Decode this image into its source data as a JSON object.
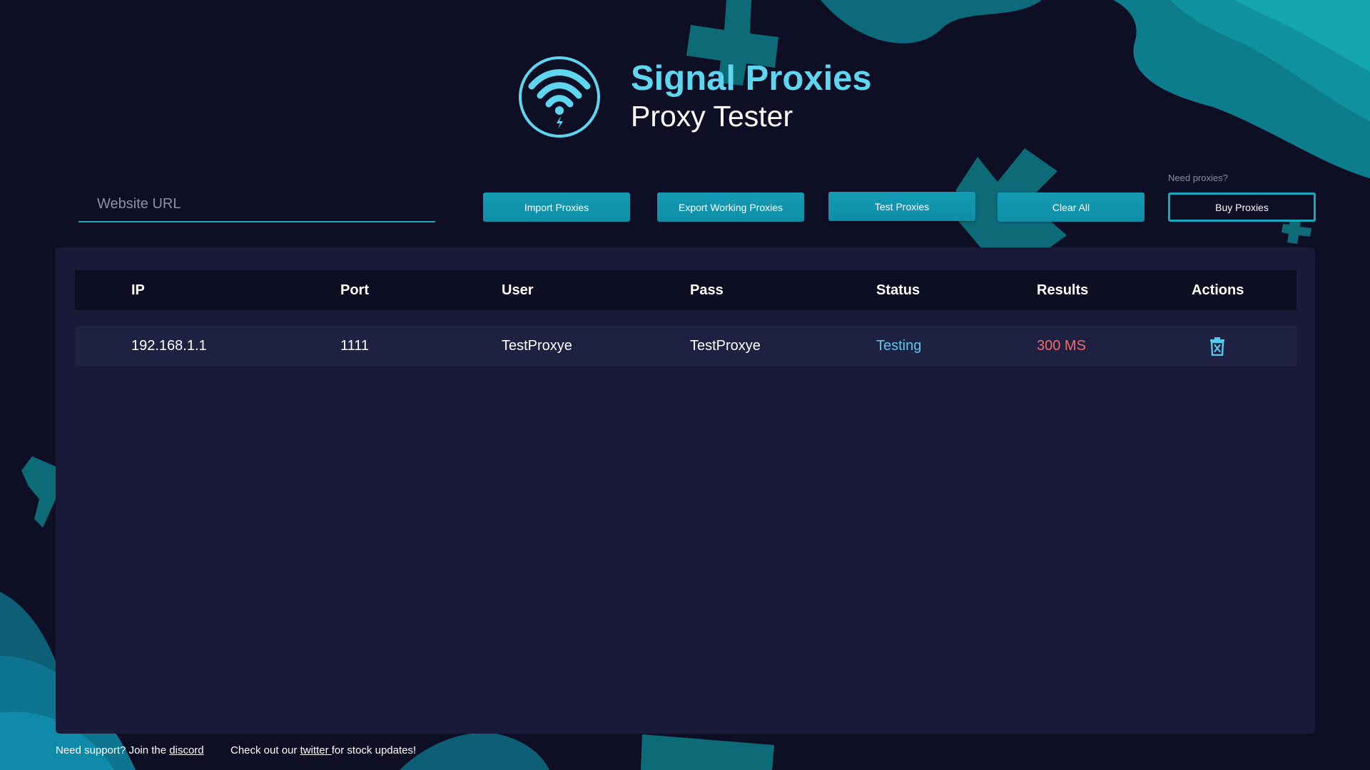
{
  "brand": {
    "title": "Signal Proxies",
    "subtitle": "Proxy Tester",
    "logo_icon": "wifi-bolt-icon"
  },
  "search": {
    "placeholder": "Website URL",
    "value": ""
  },
  "toolbar": {
    "import_label": "Import Proxies",
    "export_label": "Export Working Proxies",
    "test_label": "Test Proxies",
    "clear_label": "Clear All",
    "need_proxies_label": "Need proxies?",
    "buy_label": "Buy Proxies"
  },
  "table": {
    "headers": [
      "IP",
      "Port",
      "User",
      "Pass",
      "Status",
      "Results",
      "Actions"
    ],
    "rows": [
      {
        "ip": "192.168.1.1",
        "port": "1111",
        "user": "TestProxye",
        "pass": "TestProxye",
        "status": "Testing",
        "result": "300 MS",
        "action_icon": "trash-icon"
      }
    ]
  },
  "footer": {
    "support_prefix": "Need support? Join the ",
    "support_link": "discord",
    "twitter_prefix": "Check out our ",
    "twitter_link": "twitter ",
    "twitter_suffix": "for stock updates!"
  },
  "colors": {
    "background": "#0e0f25",
    "panel": "#181a37",
    "accent": "#149cb4",
    "brand_title": "#5fd6f0",
    "status_testing": "#58c9e8",
    "result": "#f26a6a"
  }
}
